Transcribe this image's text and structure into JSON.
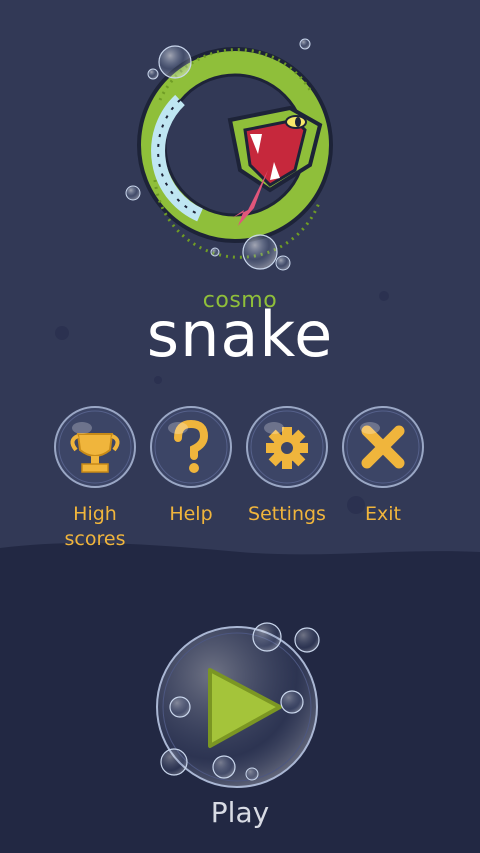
{
  "game": {
    "title_small": "cosmo",
    "title_big": "snake"
  },
  "menu": [
    {
      "label_line1": "High",
      "label_line2": "scores",
      "icon": "trophy-icon"
    },
    {
      "label_line1": "Help",
      "icon": "question-icon"
    },
    {
      "label_line1": "Settings",
      "icon": "gear-icon"
    },
    {
      "label_line1": "Exit",
      "icon": "x-icon"
    }
  ],
  "play": {
    "label": "Play",
    "icon": "play-icon"
  },
  "colors": {
    "background_top": "#323956",
    "background_bottom": "#222843",
    "accent_orange": "#f0b53c",
    "snake_green": "#8fbf3a",
    "play_green": "#a4c43a"
  }
}
